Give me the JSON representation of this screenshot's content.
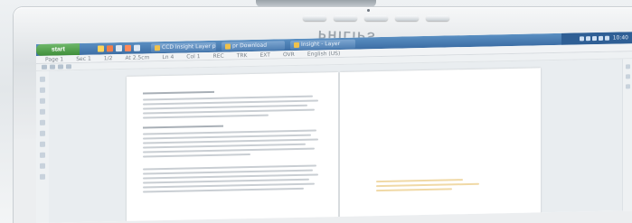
{
  "monitor": {
    "brand": "PHILIPS"
  },
  "taskbar": {
    "start_label": "start",
    "quick_launch_icons": [
      "folder-icon",
      "media-icon",
      "browser-icon",
      "app-icon",
      "window-icon"
    ],
    "tasks": [
      {
        "label": "CCD Insight Layer pe..."
      },
      {
        "label": "pr Download"
      },
      {
        "label": "Insight - Layer"
      }
    ],
    "tray_icons": [
      "network-icon",
      "volume-icon",
      "security-icon",
      "update-icon",
      "language-icon"
    ],
    "clock": "10:40"
  },
  "menu": {
    "items": [
      "Page 1",
      "Sec 1",
      "1/2",
      "At 2.5cm",
      "Ln 4",
      "Col 1",
      "REC",
      "TRK",
      "EXT",
      "OVR",
      "English (US)"
    ]
  },
  "document": {
    "pages": [
      "left-page",
      "right-page"
    ]
  }
}
